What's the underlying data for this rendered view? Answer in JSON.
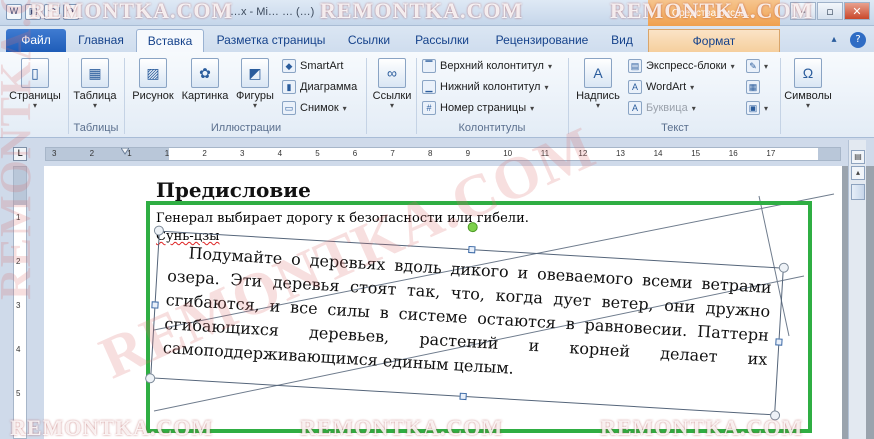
{
  "window": {
    "title": "…x - Mi… … (…)",
    "context_tab_group": "Средства рисов…",
    "buttons": [
      "–",
      "▫",
      "✕"
    ]
  },
  "tabs": [
    {
      "label": "Файл"
    },
    {
      "label": "Главная"
    },
    {
      "label": "Вставка"
    },
    {
      "label": "Разметка страницы"
    },
    {
      "label": "Ссылки"
    },
    {
      "label": "Рассылки"
    },
    {
      "label": "Рецензирование"
    },
    {
      "label": "Вид"
    },
    {
      "label": "Формат"
    }
  ],
  "ribbon": {
    "pages": {
      "label": "Страницы"
    },
    "table": {
      "label": "Таблица",
      "group": "Таблицы"
    },
    "picture": {
      "label": "Рисунок"
    },
    "clipart": {
      "label": "Картинка"
    },
    "shapes": {
      "label": "Фигуры"
    },
    "smartart": {
      "label": "SmartArt"
    },
    "chart": {
      "label": "Диаграмма"
    },
    "screenshot": {
      "label": "Снимок"
    },
    "illustrations_group": "Иллюстрации",
    "links": {
      "label": "Ссылки"
    },
    "header": {
      "label": "Верхний колонтитул"
    },
    "footer": {
      "label": "Нижний колонтитул"
    },
    "page_number": {
      "label": "Номер страницы"
    },
    "header_footer_group": "Колонтитулы",
    "textbox": {
      "label": "Надпись"
    },
    "quick_parts": {
      "label": "Экспресс-блоки"
    },
    "wordart": {
      "label": "WordArt"
    },
    "dropcap": {
      "label": "Буквица"
    },
    "text_group": "Текст",
    "symbols": {
      "label": "Символы"
    }
  },
  "ruler": {
    "h_ticks": [
      "3",
      "2",
      "1",
      "1",
      "2",
      "3",
      "4",
      "5",
      "6",
      "7",
      "8",
      "9",
      "10",
      "11",
      "12",
      "13",
      "14",
      "15",
      "16",
      "17"
    ],
    "v_ticks": [
      "1",
      "2",
      "3",
      "4",
      "5"
    ]
  },
  "document": {
    "heading": "Предисловие",
    "epigraph_line1": "Генерал выбирает дорогу к безопасности или гибели.",
    "epigraph_line2": "Сунь-цзы",
    "textbox_text": "Подумайте о деревьях вдоль дикого и овеваемого всеми ветрами озера. Эти деревья стоят так, что, когда дует ветер, они дружно сгибаются, и все силы в системе остаются в равновесии. Паттерн сгибающихся деревьев, растений и корней делает их самоподдерживающимся единым целым."
  },
  "watermark": "REMONTKA.COM",
  "colors": {
    "file_tab": "#1f5db8",
    "selection_frame": "#2fae43",
    "rotate_handle": "#7ed14d",
    "context_tab": "#ee9b45"
  }
}
